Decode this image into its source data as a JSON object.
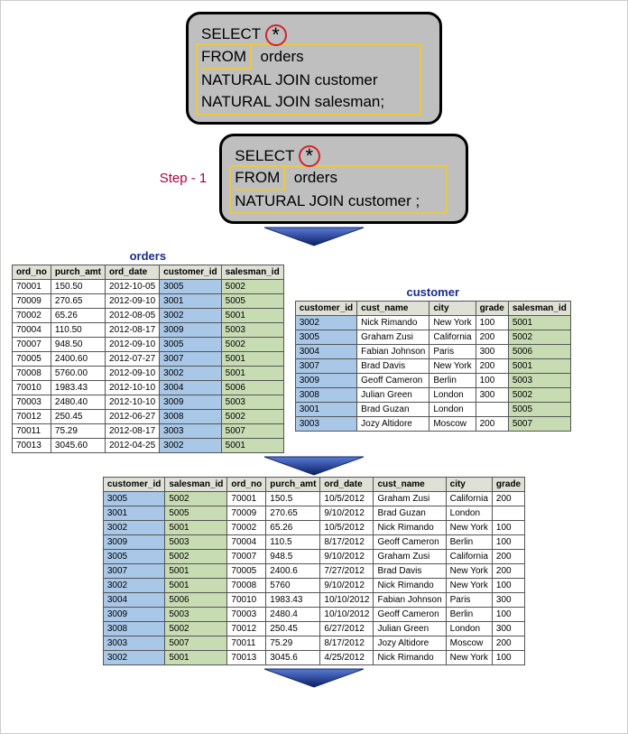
{
  "sql1": {
    "l1a": "SELECT ",
    "l1b": "*",
    "l2a": "FROM",
    "l2b": "  orders",
    "l3": "NATURAL JOIN customer",
    "l4": "NATURAL JOIN salesman;"
  },
  "sql2": {
    "l1a": "SELECT ",
    "l1b": "*",
    "l2a": "FROM",
    "l2b": "  orders",
    "l3": "NATURAL JOIN customer ;"
  },
  "step_label": "Step - 1",
  "titles": {
    "orders": "orders",
    "customer": "customer"
  },
  "orders": {
    "headers": [
      "ord_no",
      "purch_amt",
      "ord_date",
      "customer_id",
      "salesman_id"
    ],
    "rows": [
      [
        "70001",
        "150.50",
        "2012-10-05",
        "3005",
        "5002"
      ],
      [
        "70009",
        "270.65",
        "2012-09-10",
        "3001",
        "5005"
      ],
      [
        "70002",
        "65.26",
        "2012-08-05",
        "3002",
        "5001"
      ],
      [
        "70004",
        "110.50",
        "2012-08-17",
        "3009",
        "5003"
      ],
      [
        "70007",
        "948.50",
        "2012-09-10",
        "3005",
        "5002"
      ],
      [
        "70005",
        "2400.60",
        "2012-07-27",
        "3007",
        "5001"
      ],
      [
        "70008",
        "5760.00",
        "2012-09-10",
        "3002",
        "5001"
      ],
      [
        "70010",
        "1983.43",
        "2012-10-10",
        "3004",
        "5006"
      ],
      [
        "70003",
        "2480.40",
        "2012-10-10",
        "3009",
        "5003"
      ],
      [
        "70012",
        "250.45",
        "2012-06-27",
        "3008",
        "5002"
      ],
      [
        "70011",
        "75.29",
        "2012-08-17",
        "3003",
        "5007"
      ],
      [
        "70013",
        "3045.60",
        "2012-04-25",
        "3002",
        "5001"
      ]
    ]
  },
  "customer": {
    "headers": [
      "customer_id",
      "cust_name",
      "city",
      "grade",
      "salesman_id"
    ],
    "rows": [
      [
        "3002",
        "Nick Rimando",
        "New York",
        "100",
        "5001"
      ],
      [
        "3005",
        "Graham Zusi",
        "California",
        "200",
        "5002"
      ],
      [
        "3004",
        "Fabian Johnson",
        "Paris",
        "300",
        "5006"
      ],
      [
        "3007",
        "Brad Davis",
        "New York",
        "200",
        "5001"
      ],
      [
        "3009",
        "Geoff Cameron",
        "Berlin",
        "100",
        "5003"
      ],
      [
        "3008",
        "Julian Green",
        "London",
        "300",
        "5002"
      ],
      [
        "3001",
        "Brad Guzan",
        "London",
        "",
        "5005"
      ],
      [
        "3003",
        "Jozy Altidore",
        "Moscow",
        "200",
        "5007"
      ]
    ]
  },
  "joined": {
    "headers": [
      "customer_id",
      "salesman_id",
      "ord_no",
      "purch_amt",
      "ord_date",
      "cust_name",
      "city",
      "grade"
    ],
    "rows": [
      [
        "3005",
        "5002",
        "70001",
        "150.5",
        "10/5/2012",
        "Graham Zusi",
        "California",
        "200"
      ],
      [
        "3001",
        "5005",
        "70009",
        "270.65",
        "9/10/2012",
        "Brad Guzan",
        "London",
        ""
      ],
      [
        "3002",
        "5001",
        "70002",
        "65.26",
        "10/5/2012",
        "Nick Rimando",
        "New York",
        "100"
      ],
      [
        "3009",
        "5003",
        "70004",
        "110.5",
        "8/17/2012",
        "Geoff Cameron",
        "Berlin",
        "100"
      ],
      [
        "3005",
        "5002",
        "70007",
        "948.5",
        "9/10/2012",
        "Graham Zusi",
        "California",
        "200"
      ],
      [
        "3007",
        "5001",
        "70005",
        "2400.6",
        "7/27/2012",
        "Brad Davis",
        "New York",
        "200"
      ],
      [
        "3002",
        "5001",
        "70008",
        "5760",
        "9/10/2012",
        "Nick Rimando",
        "New York",
        "100"
      ],
      [
        "3004",
        "5006",
        "70010",
        "1983.43",
        "10/10/2012",
        "Fabian Johnson",
        "Paris",
        "300"
      ],
      [
        "3009",
        "5003",
        "70003",
        "2480.4",
        "10/10/2012",
        "Geoff Cameron",
        "Berlin",
        "100"
      ],
      [
        "3008",
        "5002",
        "70012",
        "250.45",
        "6/27/2012",
        "Julian Green",
        "London",
        "300"
      ],
      [
        "3003",
        "5007",
        "70011",
        "75.29",
        "8/17/2012",
        "Jozy Altidore",
        "Moscow",
        "200"
      ],
      [
        "3002",
        "5001",
        "70013",
        "3045.6",
        "4/25/2012",
        "Nick Rimando",
        "New York",
        "100"
      ]
    ]
  }
}
